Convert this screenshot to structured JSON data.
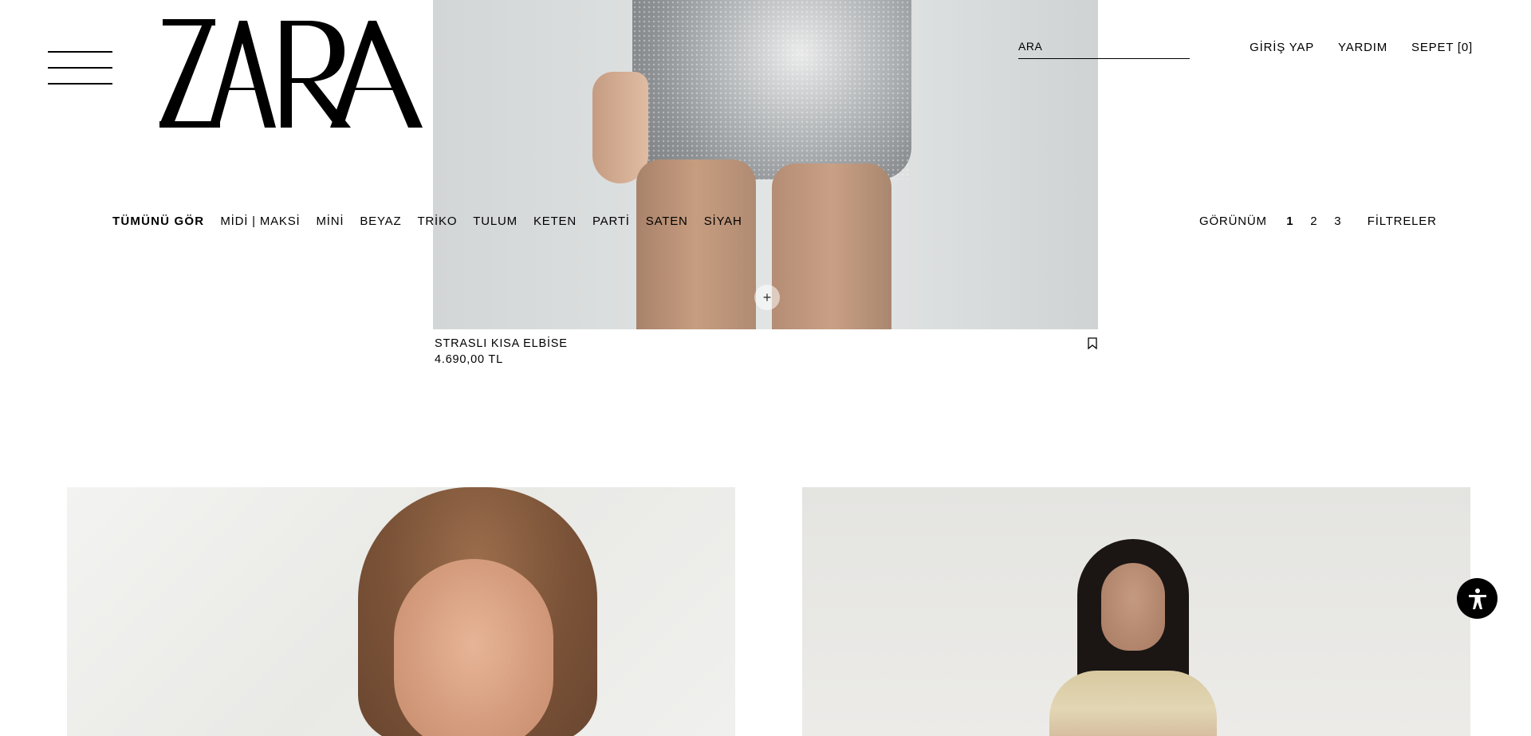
{
  "header": {
    "logo_text": "ZARA",
    "search_placeholder": "ARA",
    "links": {
      "login": "GİRİŞ YAP",
      "help": "YARDIM",
      "cart": "SEPET [0]"
    }
  },
  "category_nav": {
    "items": [
      "TÜMÜNÜ GÖR",
      "MİDİ | MAKSİ",
      "MİNİ",
      "BEYAZ",
      "TRİKO",
      "TULUM",
      "KETEN",
      "PARTİ",
      "SATEN",
      "SİYAH"
    ],
    "active": "TÜMÜNÜ GÖR"
  },
  "view_controls": {
    "label": "GÖRÜNÜM",
    "options": [
      "1",
      "2",
      "3"
    ],
    "active": "1",
    "filters": "FİLTRELER"
  },
  "product": {
    "name": "STRASLI KISA ELBİSE",
    "price": "4.690,00 TL",
    "add_icon": "plus-icon",
    "bookmark_icon": "bookmark-icon"
  },
  "accessibility": {
    "icon": "accessibility-icon",
    "color": "#000000"
  }
}
